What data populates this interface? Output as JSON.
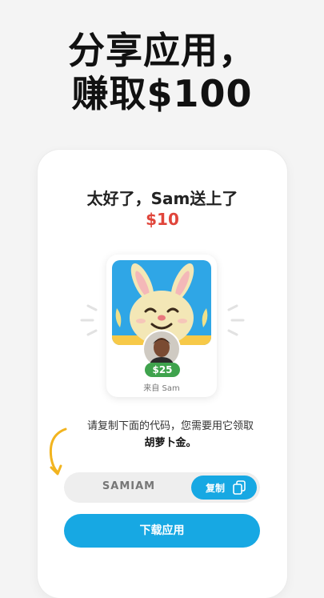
{
  "headline": {
    "line1": "分享应用，",
    "line2": "赚取$100"
  },
  "gift": {
    "title": "太好了，Sam送上了",
    "amount": "$10"
  },
  "card": {
    "reward_badge": "$25",
    "from_label": "来自 Sam"
  },
  "instructions": {
    "line1": "请复制下面的代码，您需要用它领取",
    "line2": "胡萝卜金。"
  },
  "code": {
    "value": "SAMIAM",
    "copy_label": "复制"
  },
  "download": {
    "label": "下载应用"
  },
  "icons": {
    "copy": "copy-icon",
    "arrow": "curved-arrow-icon",
    "mascot": "bunny-illustration",
    "avatar": "user-avatar"
  },
  "colors": {
    "accent": "#17a8e3",
    "amount": "#e0453b",
    "badge": "#3fa34d",
    "arrow": "#f2b41f",
    "art_bg": "#2fa6e6"
  }
}
